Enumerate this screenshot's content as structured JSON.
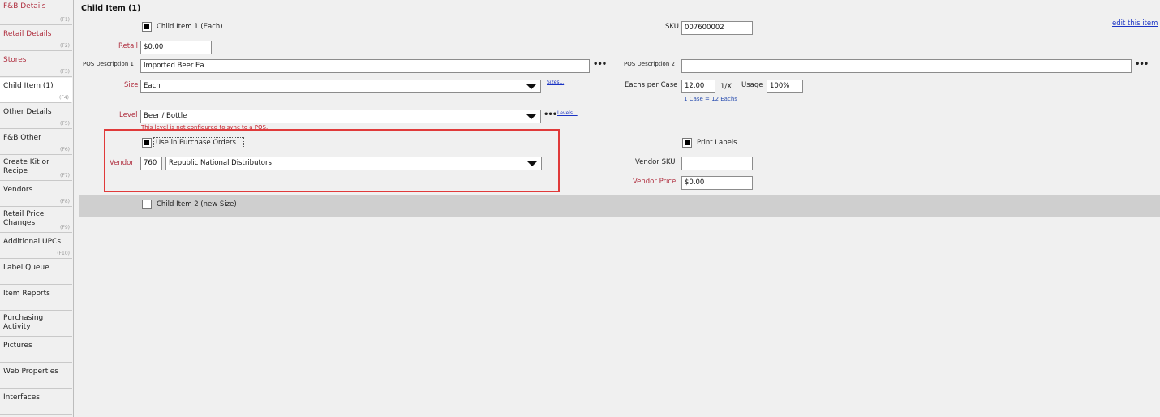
{
  "sidebar": {
    "items": [
      {
        "label": "F&B Details",
        "key": "(F1)",
        "red": true
      },
      {
        "label": "Retail Details",
        "key": "(F2)",
        "red": true
      },
      {
        "label": "Stores",
        "key": "(F3)",
        "red": true
      },
      {
        "label": "Child Item (1)",
        "key": "(F4)",
        "red": false,
        "active": true
      },
      {
        "label": "Other Details",
        "key": "(F5)",
        "red": false
      },
      {
        "label": "F&B Other",
        "key": "(F6)",
        "red": false
      },
      {
        "label": "Create Kit or Recipe",
        "key": "(F7)",
        "red": false
      },
      {
        "label": "Vendors",
        "key": "(F8)",
        "red": false
      },
      {
        "label": "Retail Price Changes",
        "key": "(F9)",
        "red": false
      },
      {
        "label": "Additional UPCs",
        "key": "(F10)",
        "red": false
      },
      {
        "label": "Label Queue",
        "key": "",
        "red": false
      },
      {
        "label": "Item Reports",
        "key": "",
        "red": false
      },
      {
        "label": "Purchasing Activity",
        "key": "",
        "red": false
      },
      {
        "label": "Pictures",
        "key": "",
        "red": false
      },
      {
        "label": "Web Properties",
        "key": "",
        "red": false
      },
      {
        "label": "Interfaces",
        "key": "",
        "red": false
      }
    ]
  },
  "main": {
    "title": "Child Item (1)",
    "child1_label": "Child Item 1 (Each)",
    "sku_label": "SKU",
    "sku_value": "007600002",
    "edit_link": "edit this item",
    "retail_label": "Retail",
    "retail_value": "$0.00",
    "pos_desc1_label": "POS Description 1",
    "pos_desc1_value": "Imported Beer Ea",
    "pos_desc2_label": "POS Description 2",
    "pos_desc2_value": "",
    "size_label": "Size",
    "size_value": "Each",
    "sizes_link": "Sizes...",
    "eachs_label": "Eachs per Case",
    "eachs_value": "12.00",
    "ratio_label": "1/X",
    "usage_label": "Usage",
    "usage_value": "100%",
    "case_hint": "1 Case = 12 Eachs",
    "level_label": "Level",
    "level_value": "Beer / Bottle",
    "levels_link": "Levels...",
    "level_note": "This level is not configured to sync to a POS.",
    "use_po_label": "Use in Purchase Orders",
    "print_labels_label": "Print Labels",
    "vendor_label": "Vendor",
    "vendor_code": "760",
    "vendor_name": "Republic National Distributors",
    "vendor_sku_label": "Vendor SKU",
    "vendor_sku_value": "",
    "vendor_price_label": "Vendor Price",
    "vendor_price_value": "$0.00",
    "child2_label": "Child Item 2 (new Size)"
  },
  "icons": {
    "more": "ellipsis-icon",
    "dropdown": "triangle-down-icon"
  },
  "colors": {
    "required_label": "#b03040",
    "link": "#1a33c4",
    "highlight": "#e03a3a",
    "note": "#c2202a"
  }
}
